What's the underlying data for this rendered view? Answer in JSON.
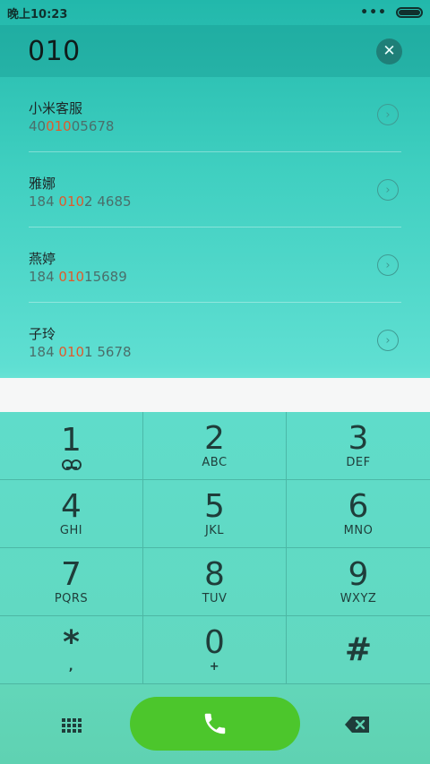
{
  "status_bar": {
    "time": "晚上10:23",
    "dots": "•••"
  },
  "dialer": {
    "input": "010",
    "clear_icon": "close-circle-icon"
  },
  "results": [
    {
      "name": "小米客服",
      "pre": "40",
      "match": "010",
      "post": "05678"
    },
    {
      "name": "雅娜",
      "pre": "184 ",
      "match": "010",
      "post": "2 4685"
    },
    {
      "name": "燕婷",
      "pre": "184 ",
      "match": "010",
      "post": "15689"
    },
    {
      "name": "子玲",
      "pre": "184 ",
      "match": "010",
      "post": "1 5678"
    }
  ],
  "keypad": [
    {
      "digit": "1",
      "letters": ""
    },
    {
      "digit": "2",
      "letters": "ABC"
    },
    {
      "digit": "3",
      "letters": "DEF"
    },
    {
      "digit": "4",
      "letters": "GHI"
    },
    {
      "digit": "5",
      "letters": "JKL"
    },
    {
      "digit": "6",
      "letters": "MNO"
    },
    {
      "digit": "7",
      "letters": "PQRS"
    },
    {
      "digit": "8",
      "letters": "TUV"
    },
    {
      "digit": "9",
      "letters": "WXYZ"
    },
    {
      "digit": "*",
      "letters": ","
    },
    {
      "digit": "0",
      "letters": "+"
    },
    {
      "digit": "#",
      "letters": ""
    }
  ],
  "colors": {
    "accent": "#4cc62c",
    "highlight": "#e05a2b",
    "teal": "#22b8ab"
  }
}
